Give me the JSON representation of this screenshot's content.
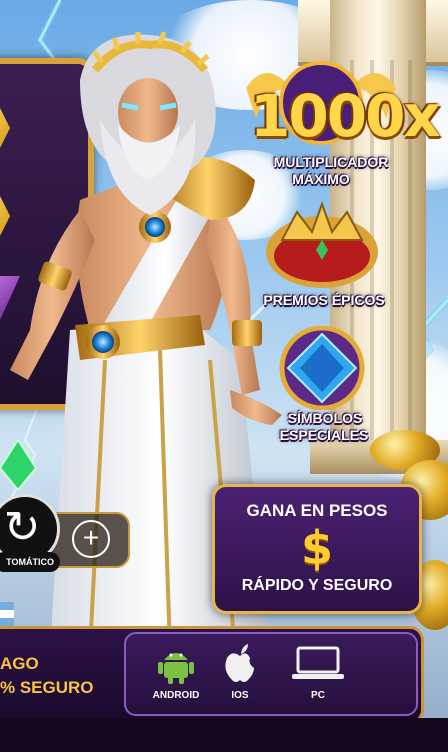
{
  "badges": {
    "multiplier_value": "1000x",
    "multiplier_line1": "MULTIPLICADOR",
    "multiplier_line2": "MÁXIMO",
    "prizes": "PREMIOS ÉPICOS",
    "symbols_line1": "SÍMBOLOS",
    "symbols_line2": "ESPECIALES"
  },
  "controls": {
    "spin_icon": "↻",
    "plus_icon": "+",
    "auto_label": "TOMÁTICO"
  },
  "win_box": {
    "title": "GANA EN PESOS",
    "currency_symbol": "$",
    "subtitle": "RÁPIDO Y SEGURO"
  },
  "footer": {
    "left_line1": "AGO",
    "left_line2": "% SEGURO",
    "platforms": [
      {
        "label": "ANDROID",
        "icon": "android-icon"
      },
      {
        "label": "IOS",
        "icon": "apple-icon"
      },
      {
        "label": "PC",
        "icon": "laptop-icon"
      }
    ]
  },
  "colors": {
    "gold": "#ffd54a",
    "purple": "#3b1a5c",
    "android_green": "#7cc242"
  }
}
